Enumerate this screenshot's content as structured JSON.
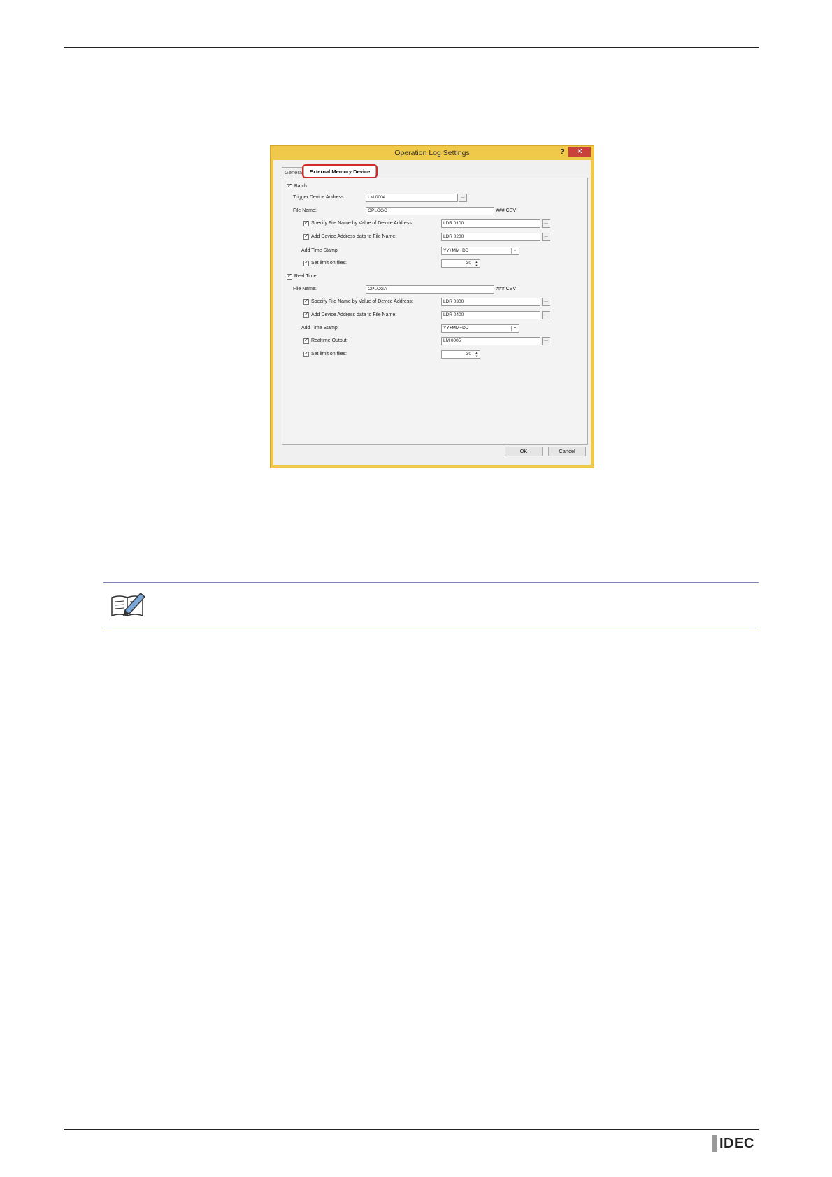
{
  "dialog": {
    "title": "Operation Log Settings",
    "help": "?",
    "close": "✕",
    "tabs": {
      "general": "General",
      "external": "External Memory Device"
    },
    "batch": {
      "label": "Batch",
      "trigger_label": "Trigger Device Address:",
      "trigger_value": "LM 0004",
      "filename_label": "File Name:",
      "filename_value": "OPLOGO",
      "ext": "###.CSV",
      "specify_label": "Specify File Name by Value of Device Address:",
      "specify_value": "LDR 0100",
      "add_label": "Add Device Address data to File Name:",
      "add_value": "LDR 0200",
      "timestamp_label": "Add Time Stamp:",
      "timestamp_value": "YY+MM+DD",
      "limit_label": "Set limit on files:",
      "limit_value": "30"
    },
    "realtime": {
      "label": "Real Time",
      "filename_label": "File Name:",
      "filename_value": "OPLOGA",
      "ext": "###.CSV",
      "specify_label": "Specify File Name by Value of Device Address:",
      "specify_value": "LDR 0300",
      "add_label": "Add Device Address data to File Name:",
      "add_value": "LDR 0400",
      "timestamp_label": "Add Time Stamp:",
      "timestamp_value": "YY+MM+DD",
      "output_label": "Realtime Output:",
      "output_value": "LM 0005",
      "limit_label": "Set limit on files:",
      "limit_value": "30"
    },
    "browse": "...",
    "ok": "OK",
    "cancel": "Cancel"
  },
  "footer": {
    "logo": "IDEC"
  },
  "colors": {
    "title_bar": "#f0c84a",
    "highlight": "#d22b2b",
    "note_rule": "#7c86b0"
  }
}
